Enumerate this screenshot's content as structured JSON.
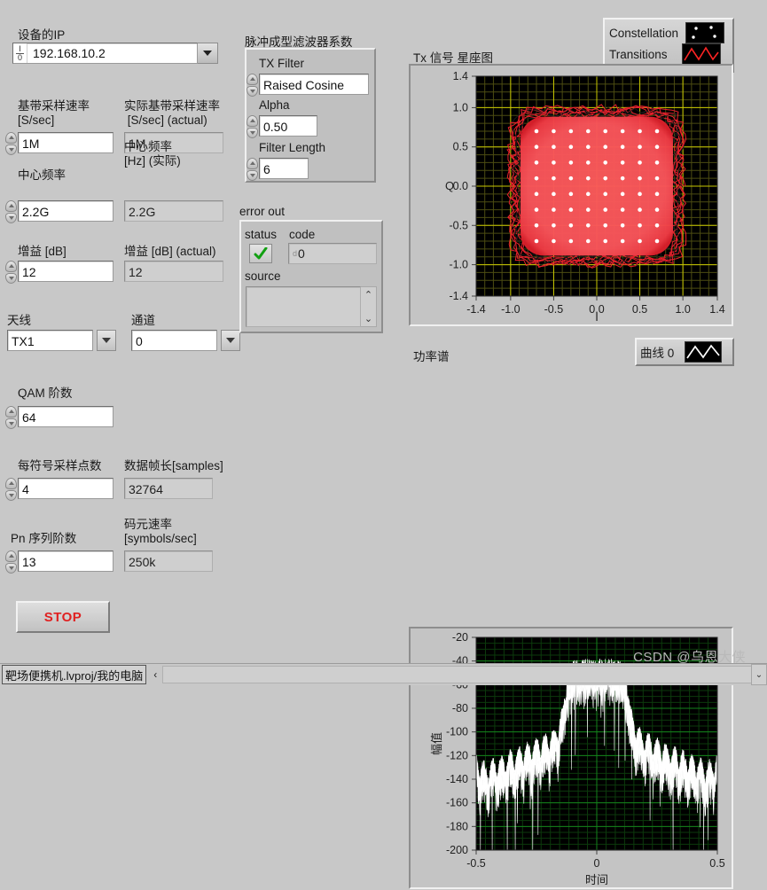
{
  "window": {
    "background": "#c8c8c8",
    "statusbar": {
      "project_tab": "靶场便携机.lvproj/我的电脑",
      "left_arrow": "‹",
      "scroll_glyph": "⌄"
    },
    "watermark": "CSDN @乌恩大侠"
  },
  "device": {
    "ip_label": "设备的IP",
    "ip_value": "192.168.10.2",
    "ip_icon": "io-glyph-icon",
    "dropdown_icon": "chevron-down-icon"
  },
  "controls": [
    {
      "label": "基带采样速率\n[S/sec]",
      "value": "1M",
      "readonly": false,
      "spinner": true
    },
    {
      "label": "实际基带采样速率\n [S/sec] (actual)",
      "value": "1M",
      "readonly": true,
      "spinner": false
    },
    {
      "label": "中心频率",
      "value": "2.2G",
      "readonly": false,
      "spinner": true
    },
    {
      "label": "中心频率\n[Hz] (实际)",
      "value": "2.2G",
      "readonly": true,
      "spinner": false
    },
    {
      "label": "增益 [dB]",
      "value": "12",
      "readonly": false,
      "spinner": true
    },
    {
      "label": "增益 [dB] (actual)",
      "value": "12",
      "readonly": true,
      "spinner": false
    },
    {
      "label": "天线",
      "value": "TX1",
      "readonly": false,
      "spinner": false,
      "combo": true
    },
    {
      "label": "通道",
      "value": "0",
      "readonly": false,
      "spinner": false,
      "combo": true
    },
    {
      "label": "QAM 阶数",
      "value": "64",
      "readonly": false,
      "spinner": true
    },
    {
      "label": "每符号采样点数",
      "value": "4",
      "readonly": false,
      "spinner": true
    },
    {
      "label": "数据帧长[samples]",
      "value": "32764",
      "readonly": true,
      "spinner": false
    },
    {
      "label": "Pn 序列阶数",
      "value": "13",
      "readonly": false,
      "spinner": true
    },
    {
      "label": "码元速率\n[symbols/sec]",
      "value": "250k",
      "readonly": true,
      "spinner": false
    }
  ],
  "stop_button": {
    "label": "STOP",
    "color": "#e02020"
  },
  "filter_group": {
    "title": "脉冲成型滤波器系数",
    "items": [
      {
        "label": "TX Filter",
        "value": "Raised Cosine"
      },
      {
        "label": "Alpha",
        "value": "0.50"
      },
      {
        "label": "Filter Length",
        "value": "6"
      }
    ]
  },
  "error_out": {
    "title": "error out",
    "status_label": "status",
    "status_icon": "green-check-icon",
    "code_label": "code",
    "code_value": "0",
    "code_prefix_icon": "numeric-badge-icon",
    "source_label": "source",
    "source_value": "",
    "scroll_up_icon": "chevron-up-icon",
    "scroll_down_icon": "chevron-down-icon"
  },
  "constellation_panel": {
    "title": "Tx 信号 星座图",
    "legend": [
      {
        "label": "Constellation",
        "swatch": "dots",
        "color": "#ffffff"
      },
      {
        "label": "Transitions",
        "swatch": "wave",
        "color": "#ff2424"
      }
    ]
  },
  "spectrum_panel": {
    "title": "功率谱",
    "legend": [
      {
        "label": "曲线 0",
        "swatch": "wave",
        "color": "#ffffff"
      }
    ]
  },
  "chart_data": [
    {
      "type": "scatter",
      "title": "Tx 信号 星座图",
      "xlabel": "I",
      "ylabel": "Q",
      "xlim": [
        -1.4,
        1.4
      ],
      "ylim": [
        -1.4,
        1.4
      ],
      "xticks": [
        "-1.4",
        "-1.0",
        "-0.5",
        "0.0",
        "0.5",
        "1.0",
        "1.4"
      ],
      "xtick_values": [
        -1.4,
        -1.0,
        -0.5,
        0.0,
        0.5,
        1.0,
        1.4
      ],
      "yticks": [
        "1.4",
        "1.0",
        "0.5",
        "0.0",
        "-0.5",
        "-1.0",
        "-1.4"
      ],
      "ytick_values": [
        1.4,
        1.0,
        0.5,
        0.0,
        -0.5,
        -1.0,
        -1.4
      ],
      "grid": true,
      "grid_color": "#b0b000",
      "plot_bg": "#000000",
      "legend_position": "top-right",
      "series": [
        {
          "name": "Constellation",
          "type": "scatter",
          "color": "#ffffff",
          "note": "64-QAM ideal symbol grid: 8x8 lattice",
          "levels": [
            -0.7,
            -0.5,
            -0.3,
            -0.1,
            0.1,
            0.3,
            0.5,
            0.7
          ]
        },
        {
          "name": "Transitions",
          "type": "line",
          "color": "#ff2424",
          "note": "Dense continuous transition trajectories filling a rounded square of half-extent about 0.9"
        }
      ]
    },
    {
      "type": "line",
      "title": "功率谱",
      "xlabel": "时间",
      "ylabel": "幅值",
      "xlim": [
        -0.5,
        0.5
      ],
      "ylim": [
        -200,
        -20
      ],
      "xticks": [
        "-0.5",
        "0",
        "0.5"
      ],
      "xtick_values": [
        -0.5,
        0,
        0.5
      ],
      "yticks": [
        "-20",
        "-40",
        "-60",
        "-80",
        "-100",
        "-120",
        "-140",
        "-160",
        "-180",
        "-200"
      ],
      "ytick_values": [
        -20,
        -40,
        -60,
        -80,
        -100,
        -120,
        -140,
        -160,
        -180,
        -200
      ],
      "grid": true,
      "grid_color": "#0a5a0a",
      "plot_bg": "#000000",
      "legend_position": "top-right",
      "series": [
        {
          "name": "曲线 0",
          "color": "#ffffff",
          "x": [
            -0.5,
            -0.46,
            -0.42,
            -0.38,
            -0.34,
            -0.3,
            -0.26,
            -0.22,
            -0.18,
            -0.14,
            -0.125,
            -0.1,
            -0.06,
            -0.02,
            0.0,
            0.02,
            0.06,
            0.1,
            0.125,
            0.14,
            0.18,
            0.22,
            0.26,
            0.3,
            0.34,
            0.38,
            0.42,
            0.46,
            0.5
          ],
          "y": [
            -120,
            -128,
            -124,
            -120,
            -116,
            -112,
            -108,
            -104,
            -100,
            -80,
            -52,
            -40,
            -38,
            -38,
            -38,
            -38,
            -38,
            -40,
            -52,
            -80,
            -100,
            -104,
            -108,
            -112,
            -116,
            -120,
            -124,
            -128,
            -120
          ]
        }
      ]
    }
  ]
}
